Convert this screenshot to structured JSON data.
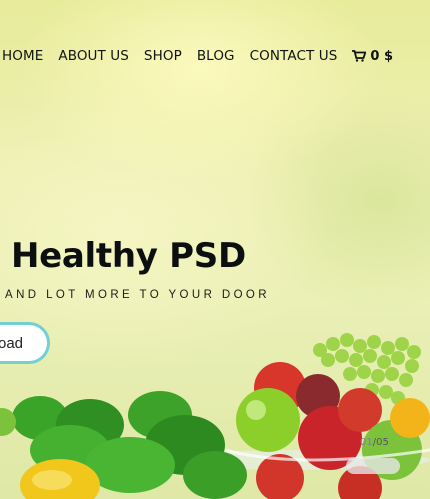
{
  "nav": {
    "items": [
      "HOME",
      "ABOUT US",
      "SHOP",
      "BLOG",
      "CONTACT US"
    ],
    "cart_label": "0 $",
    "cart_icon": "cart-icon"
  },
  "hero": {
    "headline": "Healthy PSD",
    "tagline": "AND LOT MORE TO YOUR DOOR",
    "cta_label": "load"
  },
  "slider": {
    "current": "01",
    "total": "/05"
  },
  "colors": {
    "accent": "#72cfd4",
    "text": "#0c0f10"
  }
}
